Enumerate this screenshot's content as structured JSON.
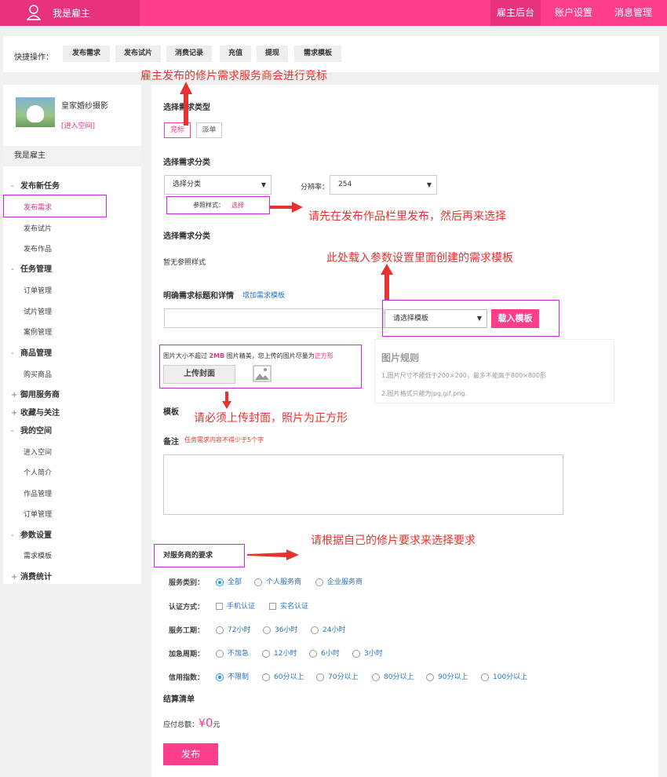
{
  "topbar": {
    "title": "我是雇主",
    "nav": [
      "雇主后台",
      "账户设置",
      "消息管理"
    ]
  },
  "quickbar": {
    "label": "快捷操作：",
    "buttons": [
      "发布需求",
      "发布试片",
      "消费记录",
      "充值",
      "提现",
      "需求模板"
    ]
  },
  "sidebar": {
    "profile_name": "皇家婚纱摄影",
    "profile_link": "[进入空间]",
    "head": "我是雇主",
    "sections": [
      {
        "sym": "-",
        "label": "发布新任务",
        "items": [
          "发布需求",
          "发布试片",
          "发布作品"
        ]
      },
      {
        "sym": "-",
        "label": "任务管理",
        "items": [
          "订单管理",
          "试片管理",
          "案例管理"
        ]
      },
      {
        "sym": "-",
        "label": "商品管理",
        "items": [
          "购买商品"
        ]
      },
      {
        "sym": "+",
        "label": "御用服务商",
        "items": []
      },
      {
        "sym": "+",
        "label": "收藏与关注",
        "items": []
      },
      {
        "sym": "-",
        "label": "我的空间",
        "items": [
          "进入空间",
          "个人简介",
          "作品管理",
          "订单管理"
        ]
      },
      {
        "sym": "-",
        "label": "参数设置",
        "items": [
          "需求模板"
        ]
      },
      {
        "sym": "+",
        "label": "消费统计",
        "items": []
      }
    ]
  },
  "form": {
    "type_label": "选择需求类型",
    "type_options": [
      "竞标",
      "派单"
    ],
    "category_label": "选择需求分类",
    "category_select": "选择分类",
    "resolution_label": "分辨率：",
    "resolution_value": "254",
    "ref_style_label": "参照样式：",
    "ref_style_link": "选择",
    "category_label2": "选择需求分类",
    "no_ref": "暂无参照样式",
    "title_label": "明确需求标题和详情",
    "add_template": "增加需求模板",
    "template_placeholder": "请选择模板",
    "load_template": "载入模板",
    "image_note_1": "图片大小不超过",
    "image_size": "2MB",
    "image_note_2": "图片精美，您上传的图片尽量为",
    "image_note_3": "正方形",
    "upload_cover": "上传封面",
    "image_rules_title": "图片规则",
    "image_rule_1": "1.图片尺寸不能低于200×200，最多不能高于800×800形",
    "image_rule_2": "2.图片格式只能为jpg,gif,png.",
    "template_label": "模板",
    "remark_label": "备注",
    "remark_hint": "任务需求内容不得少于5个字",
    "provider_req_label": "对服务商的要求",
    "service_type_label": "服务类别：",
    "service_type_opts": [
      "全部",
      "个人服务商",
      "企业服务商"
    ],
    "cert_label": "认证方式：",
    "cert_opts": [
      "手机认证",
      "实名认证"
    ],
    "period_label": "服务工期：",
    "period_opts": [
      "72小时",
      "36小时",
      "24小时"
    ],
    "urgent_label": "加急周期：",
    "urgent_opts": [
      "不加急",
      "12小时",
      "6小时",
      "3小时"
    ],
    "credit_label": "信用指数：",
    "credit_opts": [
      "不限制",
      "60分以上",
      "70分以上",
      "80分以上",
      "90分以上",
      "100分以上"
    ],
    "settle_label": "结算清单",
    "total_label": "应付总额：",
    "total_currency": "¥",
    "total_value": "0",
    "total_unit": "元",
    "publish": "发布"
  },
  "annotations": {
    "a1": "雇主发布的修片需求服务商会进行竞标",
    "a2": "请先在发布作品栏里发布，然后再来选择",
    "a3": "此处载入参数设置里面创建的需求模板",
    "a4": "请必须上传封面，照片为正方形",
    "a5": "请根据自己的修片要求来选择要求"
  },
  "colors": {
    "brand": "#ff3d8d",
    "annotation": "#e8322f",
    "link": "#2a73c2"
  }
}
